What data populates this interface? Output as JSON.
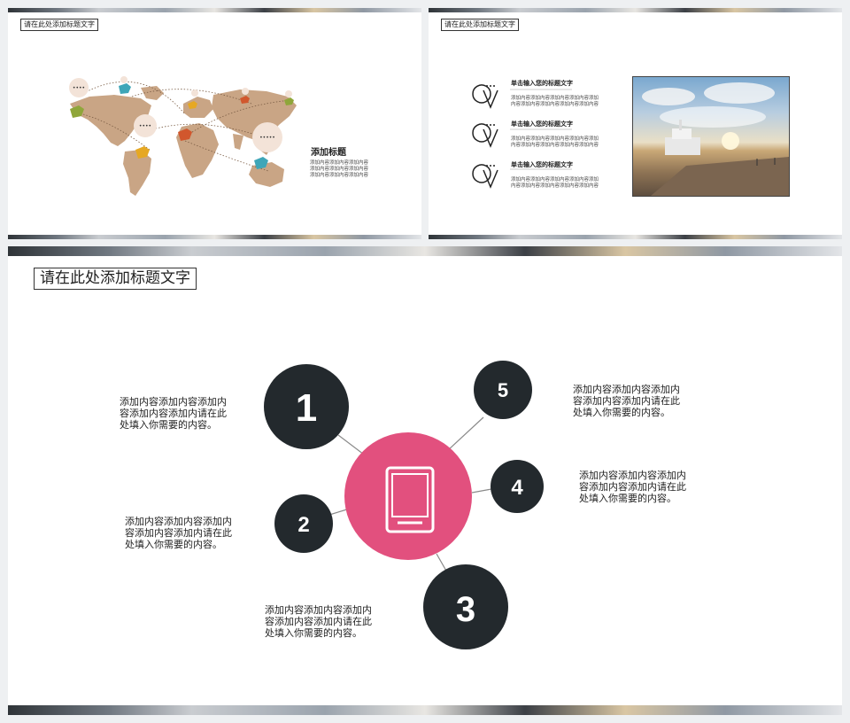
{
  "slide1": {
    "title": "请在此处添加标题文字",
    "heading": "添加标题",
    "body_lines": [
      "添加内容添加内容添加内容",
      "添加内容添加内容添加内容",
      "添加内容添加内容添加内容"
    ]
  },
  "slide2": {
    "title": "请在此处添加标题文字",
    "items": [
      {
        "title": "单击输入您的标题文字",
        "lines": [
          "添加内容添加内容添加内容添加内容添加",
          "内容添加内容添加内容添加内容添加内容"
        ]
      },
      {
        "title": "单击输入您的标题文字",
        "lines": [
          "添加内容添加内容添加内容添加内容添加",
          "内容添加内容添加内容添加内容添加内容"
        ]
      },
      {
        "title": "单击输入您的标题文字",
        "lines": [
          "添加内容添加内容添加内容添加内容添加",
          "内容添加内容添加内容添加内容添加内容"
        ]
      }
    ]
  },
  "slide3": {
    "title": "请在此处添加标题文字",
    "nodes": [
      {
        "label": "1",
        "lines": [
          "添加内容添加内容添加内",
          "容添加内容添加内请在此",
          "处填入你需要的内容。"
        ]
      },
      {
        "label": "2",
        "lines": [
          "添加内容添加内容添加内",
          "容添加内容添加内请在此",
          "处填入你需要的内容。"
        ]
      },
      {
        "label": "3",
        "lines": [
          "添加内容添加内容添加内",
          "容添加内容添加内请在此",
          "处填入你需要的内容。"
        ]
      },
      {
        "label": "4",
        "lines": [
          "添加内容添加内容添加内",
          "容添加内容添加内请在此",
          "处填入你需要的内容。"
        ]
      },
      {
        "label": "5",
        "lines": [
          "添加内容添加内容添加内",
          "容添加内容添加内请在此",
          "处填入你需要的内容。"
        ]
      }
    ],
    "colors": {
      "dark": "#23292d",
      "accent": "#e2507e"
    },
    "center_icon": "tablet-icon"
  }
}
